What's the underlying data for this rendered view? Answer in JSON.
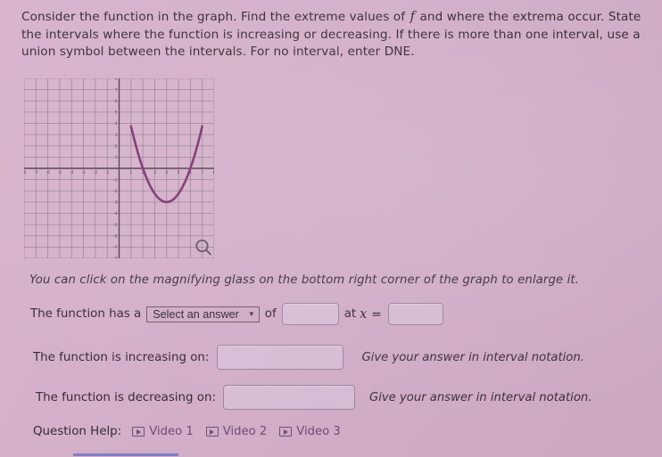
{
  "prompt": {
    "part1": "Consider the function in the graph. Find the extreme values of ",
    "fvar": "f",
    "part2": " and where the extrema occur. State the intervals where the function is increasing or decreasing. If there is more than one interval, use a union symbol between the intervals. For no interval, enter DNE."
  },
  "graph": {
    "magnifier_icon": "magnifying-glass-icon",
    "hint": "You can click on the magnifying glass on the bottom right corner of the graph to enlarge it."
  },
  "chart_data": {
    "type": "line",
    "title": "",
    "xlabel": "",
    "ylabel": "",
    "xlim": [
      -8,
      8
    ],
    "ylim": [
      -8,
      8
    ],
    "grid": true,
    "legend_position": "none",
    "xticks": [
      -8,
      -7,
      -6,
      -5,
      -4,
      -3,
      -2,
      -1,
      1,
      2,
      3,
      4,
      5,
      6,
      7,
      8
    ],
    "yticks": [
      8,
      7,
      6,
      5,
      4,
      3,
      2,
      1,
      -1,
      -2,
      -3,
      -4,
      -5,
      -6,
      -7,
      -8
    ],
    "curve_color": "#7c2f6d",
    "vertex": [
      4,
      -3
    ],
    "x_intercepts": [
      2,
      6
    ],
    "function": "y = 0.75*(x-4)^2 - 3",
    "series": [
      {
        "name": "f",
        "x": [
          1.0,
          1.2,
          1.4,
          1.6,
          1.8,
          2.0,
          2.2,
          2.4,
          2.6,
          2.8,
          3.0,
          3.2,
          3.4,
          3.6,
          3.8,
          4.0,
          4.2,
          4.4,
          4.6,
          4.8,
          5.0,
          5.2,
          5.4,
          5.6,
          5.8,
          6.0,
          6.2,
          6.4,
          6.6,
          6.8,
          7.0
        ],
        "y": [
          3.75,
          2.88,
          2.07,
          1.32,
          0.63,
          0.0,
          -0.57,
          -1.08,
          -1.53,
          -1.92,
          -2.25,
          -2.52,
          -2.73,
          -2.88,
          -2.97,
          -3.0,
          -2.97,
          -2.88,
          -2.73,
          -2.52,
          -2.25,
          -1.92,
          -1.53,
          -1.08,
          -0.57,
          0.0,
          0.63,
          1.32,
          2.07,
          2.88,
          3.75
        ]
      }
    ]
  },
  "form": {
    "extrema_row": {
      "label_before": "The function has a",
      "select_value": "Select an answer",
      "chevron_icon": "chevron-down-icon",
      "label_of": "of",
      "value_placeholder": "",
      "label_at": "at",
      "variable": "x",
      "equals": "=",
      "x_value_placeholder": ""
    },
    "increasing_row": {
      "label": "The function is increasing on:",
      "value": "",
      "note": "Give your answer in interval notation."
    },
    "decreasing_row": {
      "label": "The function is decreasing on:",
      "value": "",
      "note": "Give your answer in interval notation."
    }
  },
  "question_help": {
    "label": "Question Help:",
    "videos": [
      {
        "label": "Video 1",
        "icon": "play-video-icon"
      },
      {
        "label": "Video 2",
        "icon": "play-video-icon"
      },
      {
        "label": "Video 3",
        "icon": "play-video-icon"
      }
    ]
  }
}
